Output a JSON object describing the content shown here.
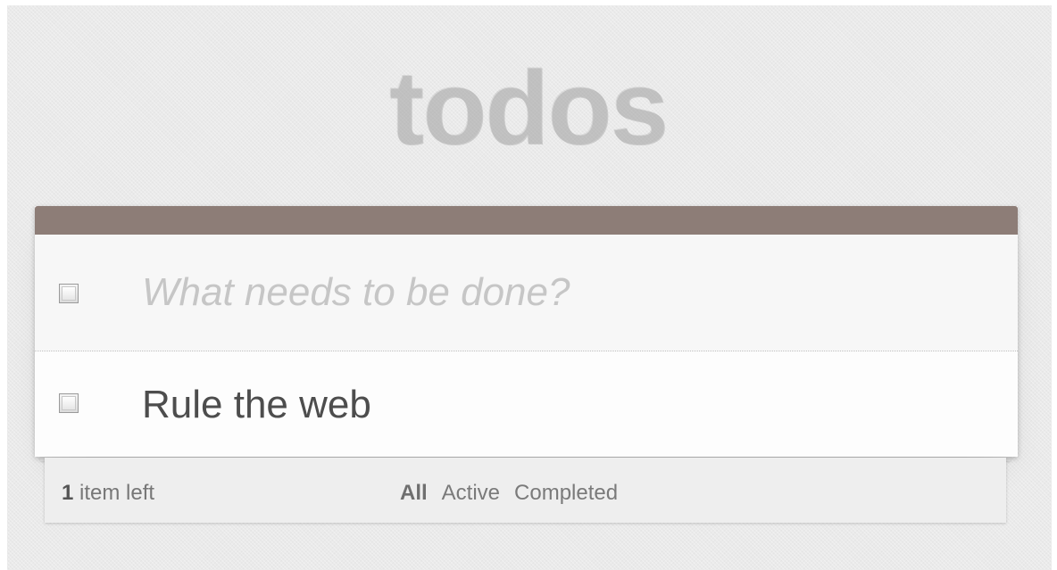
{
  "app": {
    "title": "todos"
  },
  "new_todo": {
    "placeholder": "What needs to be done?",
    "value": ""
  },
  "todos": [
    {
      "title": "Rule the web",
      "completed": false
    }
  ],
  "footer": {
    "count_number": "1",
    "count_suffix": "item left",
    "filters": [
      {
        "label": "All",
        "selected": true
      },
      {
        "label": "Active",
        "selected": false
      },
      {
        "label": "Completed",
        "selected": false
      }
    ]
  },
  "colors": {
    "header_bar": "#8d7d77",
    "title": "#c9c9c9",
    "text": "#4d4d4d"
  }
}
